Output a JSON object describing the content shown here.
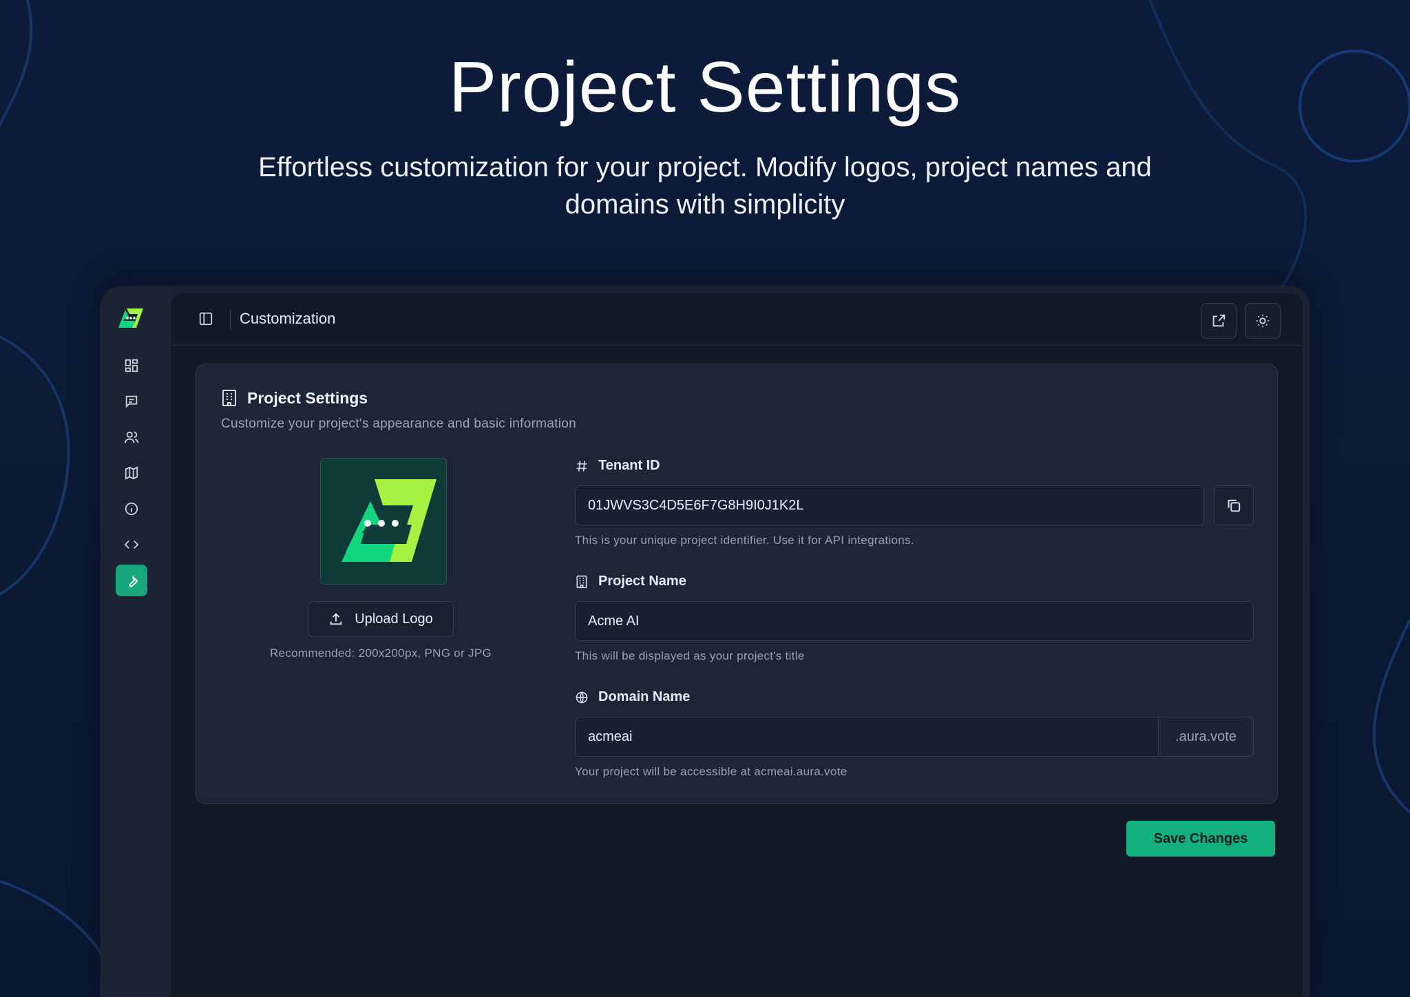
{
  "hero": {
    "title": "Project Settings",
    "subtitle": "Effortless customization for your project. Modify logos, project names and domains with simplicity"
  },
  "rail": {
    "items": [
      {
        "icon": "dashboard-icon"
      },
      {
        "icon": "message-icon"
      },
      {
        "icon": "users-icon"
      },
      {
        "icon": "map-icon"
      },
      {
        "icon": "info-icon"
      },
      {
        "icon": "code-icon"
      },
      {
        "icon": "wrench-icon",
        "active": true
      }
    ]
  },
  "topbar": {
    "title": "Customization",
    "buttons": [
      "external-link-icon",
      "sun-icon"
    ]
  },
  "card": {
    "title": "Project Settings",
    "description": "Customize your project's appearance and basic information",
    "upload_label": "Upload Logo",
    "upload_hint": "Recommended: 200x200px, PNG or JPG"
  },
  "fields": {
    "tenant": {
      "label": "Tenant ID",
      "value": "01JWVS3C4D5E6F7G8H9I0J1K2L",
      "helper": "This is your unique project identifier. Use it for API integrations."
    },
    "project_name": {
      "label": "Project Name",
      "value": "Acme AI",
      "helper": "This will be displayed as your project's title"
    },
    "domain": {
      "label": "Domain Name",
      "value": "acmeai",
      "suffix": ".aura.vote",
      "helper": "Your project will be accessible at acmeai.aura.vote"
    }
  },
  "actions": {
    "save_label": "Save Changes"
  },
  "colors": {
    "accent": "#12b07e",
    "logo_green": "#10d680",
    "logo_lime": "#a6f241",
    "background": "#0b1a35"
  }
}
